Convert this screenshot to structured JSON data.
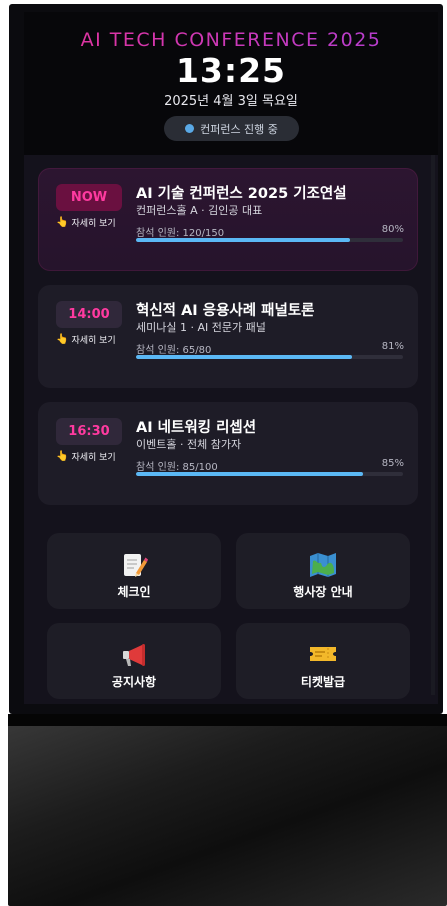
{
  "header": {
    "conference_title": "AI TECH CONFERENCE 2025",
    "time": "13:25",
    "date": "2025년 4월 3일 목요일",
    "status": "컨퍼런스 진행 중"
  },
  "sessions": [
    {
      "badge": "NOW",
      "details_label": "자세히 보기",
      "title": "AI 기술 컨퍼런스 2025 기조연설",
      "subtitle": "컨퍼런스홀 A · 김인공 대표",
      "attendance": "참석 인원: 120/150",
      "percent": "80%",
      "progress": 0.8
    },
    {
      "badge": "14:00",
      "details_label": "자세히 보기",
      "title": "혁신적 AI 응용사례 패널토론",
      "subtitle": "세미나실 1 · AI 전문가 패널",
      "attendance": "참석 인원: 65/80",
      "percent": "81%",
      "progress": 0.81
    },
    {
      "badge": "16:30",
      "details_label": "자세히 보기",
      "title": "AI 네트워킹 리셉션",
      "subtitle": "이벤트홀 · 전체 참가자",
      "attendance": "참석 인원: 85/100",
      "percent": "85%",
      "progress": 0.85
    }
  ],
  "menu": [
    {
      "label": "체크인",
      "icon": "memo-pencil-icon"
    },
    {
      "label": "행사장 안내",
      "icon": "map-icon"
    },
    {
      "label": "공지사항",
      "icon": "megaphone-icon"
    },
    {
      "label": "티켓발급",
      "icon": "ticket-icon"
    }
  ],
  "colors": {
    "accent_pink": "#ff3aa0",
    "progress_blue": "#5bb8f5",
    "status_dot": "#5aa9e6"
  }
}
